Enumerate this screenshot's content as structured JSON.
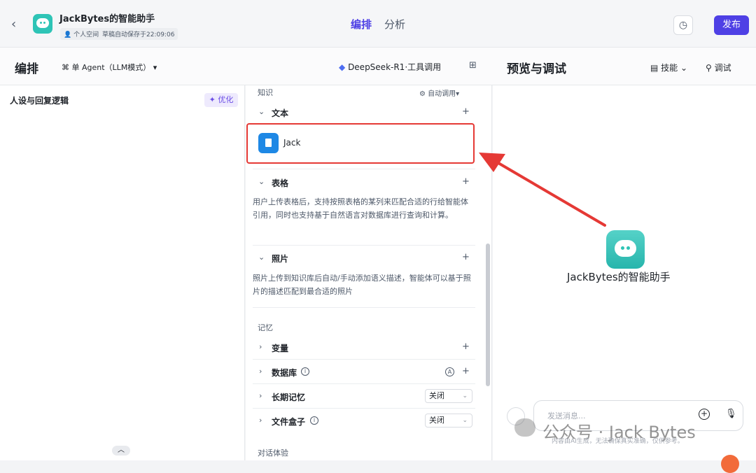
{
  "header": {
    "app_title": "JackBytes的智能助手",
    "space_tag": "个人空间",
    "autosave": "草稿自动保存于22:09:06",
    "tabs": [
      "编排",
      "分析"
    ],
    "publish": "发布"
  },
  "subbar": {
    "title": "编排",
    "agent_mode": "单 Agent（LLM模式）",
    "model": "DeepSeek-R1·工具调用",
    "preview_title": "预览与调试",
    "skills": "技能",
    "debug": "调试"
  },
  "left": {
    "persona": "人设与回复逻辑",
    "optimize": "优化"
  },
  "knowledge": {
    "label": "知识",
    "auto_call": "自动调用",
    "text_section": "文本",
    "text_item": "Jack",
    "table_section": "表格",
    "table_desc": "用户上传表格后，支持按照表格的某列来匹配合适的行给智能体引用，同时也支持基于自然语言对数据库进行查询和计算。",
    "photo_section": "照片",
    "photo_desc": "照片上传到知识库后自动/手动添加语义描述，智能体可以基于照片的描述匹配到最合适的照片"
  },
  "memory": {
    "label": "记忆",
    "variables": "变量",
    "database": "数据库",
    "long_term": "长期记忆",
    "long_term_value": "关闭",
    "file_box": "文件盒子",
    "file_box_value": "关闭"
  },
  "dialog_label": "对话体验",
  "preview": {
    "bot_name": "JackBytes的智能助手",
    "input_placeholder": "发送消息...",
    "watermark": "公众号 · Jack Bytes",
    "disclaimer": "内容由AI生成，无法确保真实准确，仅供参考。"
  },
  "colors": {
    "accent": "#4e40e5",
    "highlight": "#e53935",
    "bot": "#2ec4b6"
  }
}
